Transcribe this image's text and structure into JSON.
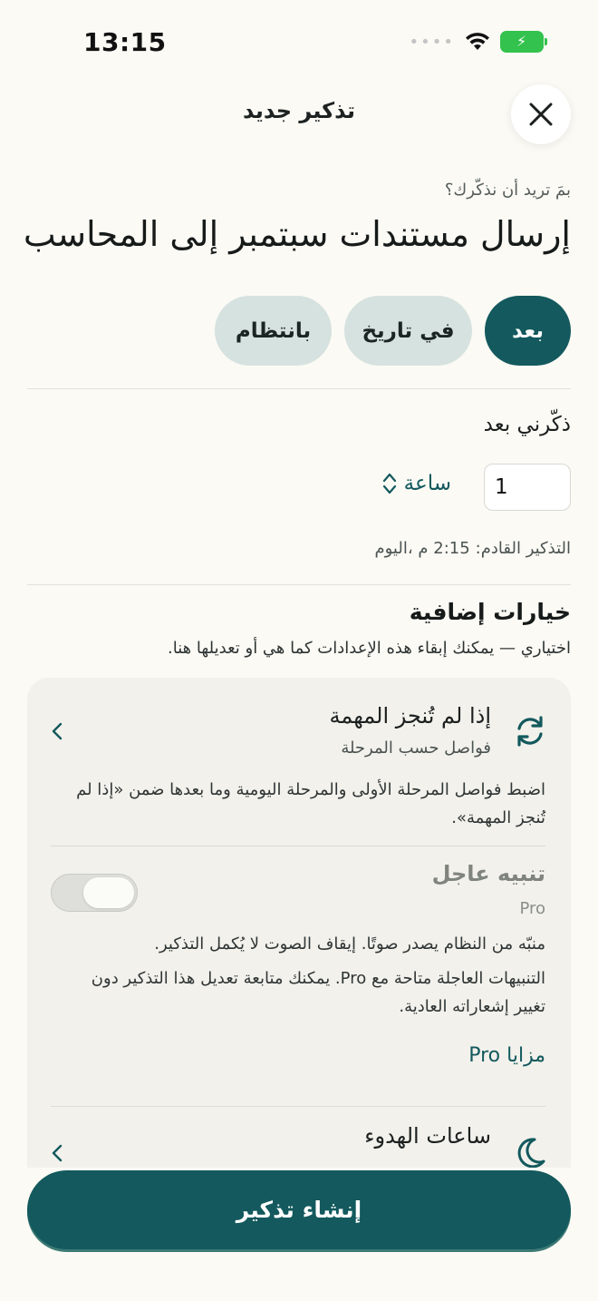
{
  "status_bar": {
    "time": "13:15"
  },
  "header": {
    "title": "تذكير جديد",
    "close_icon": "close-icon"
  },
  "reminder": {
    "question": "بمَ تريد أن نذكّرك؟",
    "title": "إرسال مستندات سبتمبر إلى المحاسب"
  },
  "schedule_tabs": [
    {
      "label": "بعد",
      "active": true
    },
    {
      "label": "في تاريخ",
      "active": false
    },
    {
      "label": "بانتظام",
      "active": false
    }
  ],
  "remind_after": {
    "label": "ذكّرني بعد",
    "amount": "1",
    "unit": "ساعة",
    "next_label": "التذكير القادم:",
    "next_value": "2:15 م ،اليوم"
  },
  "extra_options": {
    "title": "خيارات إضافية",
    "subtitle": "اختياري — يمكنك إبقاء هذه الإعدادات كما هي أو تعديلها هنا.",
    "if_not_done": {
      "title": "إذا لم تُنجز المهمة",
      "subtitle": "فواصل حسب المرحلة",
      "description": "اضبط فواصل المرحلة الأولى والمرحلة اليومية وما بعدها ضمن «إذا لم تُنجز المهمة».",
      "icon": "refresh-icon"
    },
    "urgent_alert": {
      "title": "تنبيه عاجل",
      "badge": "Pro",
      "enabled": false,
      "description": "منبّه من النظام يصدر صوتًا. إيقاف الصوت لا يُكمل التذكير.",
      "pro_note": "التنبيهات العاجلة متاحة مع Pro. يمكنك متابعة تعديل هذا التذكير دون تغيير إشعاراته العادية.",
      "pro_link": "مزايا Pro"
    },
    "quiet_hours": {
      "title": "ساعات الهدوء",
      "icon": "moon-icon"
    }
  },
  "actions": {
    "create_label": "إنشاء تذكير"
  },
  "colors": {
    "accent": "#13595d",
    "chip_inactive": "#d6e2df",
    "background": "#fbfaf5",
    "card": "#f2f1ec"
  }
}
